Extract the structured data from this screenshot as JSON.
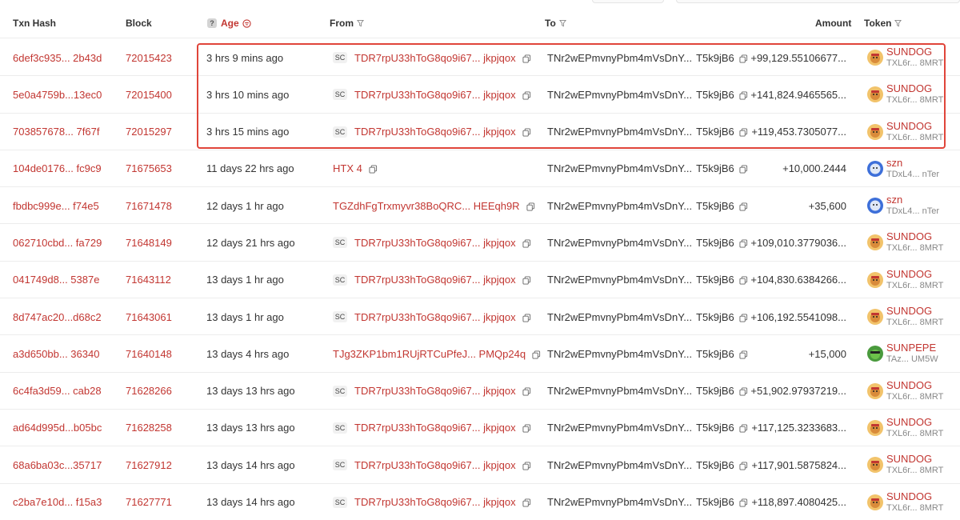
{
  "header": {
    "txn_hash": "Txn Hash",
    "block": "Block",
    "age_help": "?",
    "age": "Age",
    "from": "From",
    "to": "To",
    "amount": "Amount",
    "token": "Token"
  },
  "colors": {
    "accent": "#c23631",
    "highlight_border": "#e0453a"
  },
  "rows": [
    {
      "hash": "6def3c935... 2b43d",
      "block": "72015423",
      "age": "3 hrs 9 mins ago",
      "from_sc": "SC",
      "from": "TDR7rpU33hToG8qo9i67... jkpjqox",
      "to_head": "TNr2wEPmvnyPbm4mVsDnY...",
      "to_tail": "T5k9jB6",
      "amount": "+99,129.55106677...",
      "token_name": "SUNDOG",
      "token_addr": "TXL6r... 8MRT",
      "token_icon": "sundog-icon"
    },
    {
      "hash": "5e0a4759b...13ec0",
      "block": "72015400",
      "age": "3 hrs 10 mins ago",
      "from_sc": "SC",
      "from": "TDR7rpU33hToG8qo9i67... jkpjqox",
      "to_head": "TNr2wEPmvnyPbm4mVsDnY...",
      "to_tail": "T5k9jB6",
      "amount": "+141,824.9465565...",
      "token_name": "SUNDOG",
      "token_addr": "TXL6r... 8MRT",
      "token_icon": "sundog-icon"
    },
    {
      "hash": "703857678... 7f67f",
      "block": "72015297",
      "age": "3 hrs 15 mins ago",
      "from_sc": "SC",
      "from": "TDR7rpU33hToG8qo9i67... jkpjqox",
      "to_head": "TNr2wEPmvnyPbm4mVsDnY...",
      "to_tail": "T5k9jB6",
      "amount": "+119,453.7305077...",
      "token_name": "SUNDOG",
      "token_addr": "TXL6r... 8MRT",
      "token_icon": "sundog-icon"
    },
    {
      "hash": "104de0176... fc9c9",
      "block": "71675653",
      "age": "11 days 22 hrs ago",
      "from_sc": "",
      "from": "HTX 4",
      "to_head": "TNr2wEPmvnyPbm4mVsDnY...",
      "to_tail": "T5k9jB6",
      "amount": "+10,000.2444",
      "token_name": "szn",
      "token_addr": "TDxL4... nTer",
      "token_icon": "szn-icon"
    },
    {
      "hash": "fbdbc999e... f74e5",
      "block": "71671478",
      "age": "12 days 1 hr ago",
      "from_sc": "",
      "from": "TGZdhFgTrxmyvr38BoQRC... HEEqh9R",
      "to_head": "TNr2wEPmvnyPbm4mVsDnY...",
      "to_tail": "T5k9jB6",
      "amount": "+35,600",
      "token_name": "szn",
      "token_addr": "TDxL4... nTer",
      "token_icon": "szn-icon"
    },
    {
      "hash": "062710cbd... fa729",
      "block": "71648149",
      "age": "12 days 21 hrs ago",
      "from_sc": "SC",
      "from": "TDR7rpU33hToG8qo9i67... jkpjqox",
      "to_head": "TNr2wEPmvnyPbm4mVsDnY...",
      "to_tail": "T5k9jB6",
      "amount": "+109,010.3779036...",
      "token_name": "SUNDOG",
      "token_addr": "TXL6r... 8MRT",
      "token_icon": "sundog-icon"
    },
    {
      "hash": "041749d8... 5387e",
      "block": "71643112",
      "age": "13 days 1 hr ago",
      "from_sc": "SC",
      "from": "TDR7rpU33hToG8qo9i67... jkpjqox",
      "to_head": "TNr2wEPmvnyPbm4mVsDnY...",
      "to_tail": "T5k9jB6",
      "amount": "+104,830.6384266...",
      "token_name": "SUNDOG",
      "token_addr": "TXL6r... 8MRT",
      "token_icon": "sundog-icon"
    },
    {
      "hash": "8d747ac20...d68c2",
      "block": "71643061",
      "age": "13 days 1 hr ago",
      "from_sc": "SC",
      "from": "TDR7rpU33hToG8qo9i67... jkpjqox",
      "to_head": "TNr2wEPmvnyPbm4mVsDnY...",
      "to_tail": "T5k9jB6",
      "amount": "+106,192.5541098...",
      "token_name": "SUNDOG",
      "token_addr": "TXL6r... 8MRT",
      "token_icon": "sundog-icon"
    },
    {
      "hash": "a3d650bb... 36340",
      "block": "71640148",
      "age": "13 days 4 hrs ago",
      "from_sc": "",
      "from": "TJg3ZKP1bm1RUjRTCuPfeJ... PMQp24q",
      "to_head": "TNr2wEPmvnyPbm4mVsDnY...",
      "to_tail": "T5k9jB6",
      "amount": "+15,000",
      "token_name": "SUNPEPE",
      "token_addr": "TAz... UM5W",
      "token_icon": "sunpepe-icon"
    },
    {
      "hash": "6c4fa3d59... cab28",
      "block": "71628266",
      "age": "13 days 13 hrs ago",
      "from_sc": "SC",
      "from": "TDR7rpU33hToG8qo9i67... jkpjqox",
      "to_head": "TNr2wEPmvnyPbm4mVsDnY...",
      "to_tail": "T5k9jB6",
      "amount": "+51,902.97937219...",
      "token_name": "SUNDOG",
      "token_addr": "TXL6r... 8MRT",
      "token_icon": "sundog-icon"
    },
    {
      "hash": "ad64d995d...b05bc",
      "block": "71628258",
      "age": "13 days 13 hrs ago",
      "from_sc": "SC",
      "from": "TDR7rpU33hToG8qo9i67... jkpjqox",
      "to_head": "TNr2wEPmvnyPbm4mVsDnY...",
      "to_tail": "T5k9jB6",
      "amount": "+117,125.3233683...",
      "token_name": "SUNDOG",
      "token_addr": "TXL6r... 8MRT",
      "token_icon": "sundog-icon"
    },
    {
      "hash": "68a6ba03c...35717",
      "block": "71627912",
      "age": "13 days 14 hrs ago",
      "from_sc": "SC",
      "from": "TDR7rpU33hToG8qo9i67... jkpjqox",
      "to_head": "TNr2wEPmvnyPbm4mVsDnY...",
      "to_tail": "T5k9jB6",
      "amount": "+117,901.5875824...",
      "token_name": "SUNDOG",
      "token_addr": "TXL6r... 8MRT",
      "token_icon": "sundog-icon"
    },
    {
      "hash": "c2ba7e10d... f15a3",
      "block": "71627771",
      "age": "13 days 14 hrs ago",
      "from_sc": "SC",
      "from": "TDR7rpU33hToG8qo9i67... jkpjqox",
      "to_head": "TNr2wEPmvnyPbm4mVsDnY...",
      "to_tail": "T5k9jB6",
      "amount": "+118,897.4080425...",
      "token_name": "SUNDOG",
      "token_addr": "TXL6r... 8MRT",
      "token_icon": "sundog-icon"
    }
  ]
}
